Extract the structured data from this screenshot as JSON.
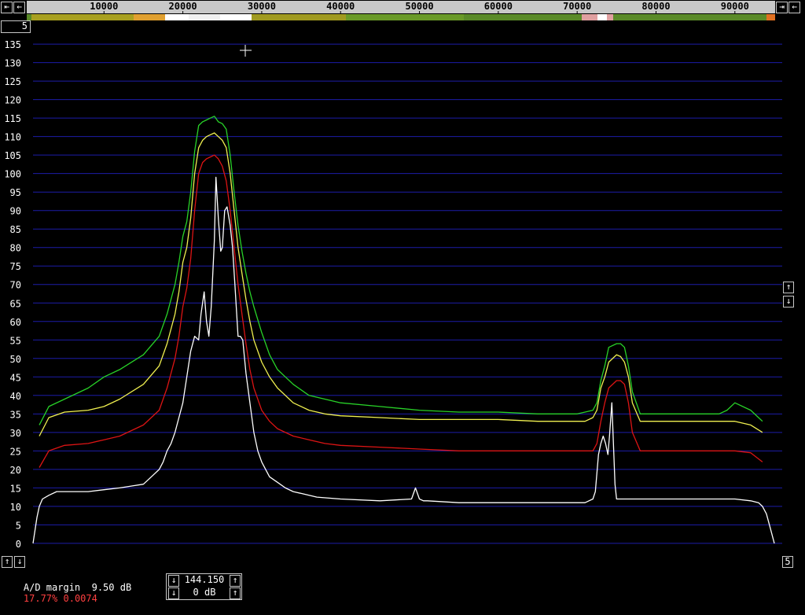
{
  "colors": {
    "background": "#000000",
    "grid": "#1c1ca8",
    "axis_text": "#ffffff",
    "frequency_ruler_bg": "#c8c8c8",
    "trace_green": "#28d228",
    "trace_yellow": "#f0f050",
    "trace_red": "#dc1414",
    "trace_white": "#ffffff",
    "status_red": "#ff4040"
  },
  "frequency_bar": {
    "left_buttons": [
      "left-arrow-icon",
      "left-arrow-icon"
    ],
    "right_buttons": [
      "right-arrow-icon",
      "left-arrow-icon"
    ],
    "top_left_box": "5"
  },
  "right_controls": {
    "up_icon": "up-arrow-icon",
    "down_icon": "down-arrow-icon",
    "bottom_right_box": "5"
  },
  "left_controls": {
    "up_icon": "up-arrow-icon",
    "down_icon": "down-arrow-icon"
  },
  "status": {
    "ad_margin_label": "A/D margin",
    "ad_margin_value": "9.50 dB",
    "percent": "17.77%",
    "ratio": "0.0074"
  },
  "freq_box": {
    "frequency": "144.150",
    "gain": "0 dB"
  },
  "chart_data": {
    "type": "line",
    "title": "",
    "xlabel": "",
    "ylabel": "",
    "x_ticks": [
      10000,
      20000,
      30000,
      40000,
      50000,
      60000,
      70000,
      80000,
      90000
    ],
    "x_tick_labels": [
      "10000",
      "20000",
      "30000",
      "40000",
      "50000",
      "60000",
      "70000",
      "80000",
      "90000"
    ],
    "xlim": [
      1000,
      96000
    ],
    "y_ticks": [
      0,
      5,
      10,
      15,
      20,
      25,
      30,
      35,
      40,
      45,
      50,
      55,
      60,
      65,
      70,
      75,
      80,
      85,
      90,
      95,
      100,
      105,
      110,
      115,
      120,
      125,
      130,
      135
    ],
    "y_tick_labels": [
      "0",
      "5",
      "10",
      "15",
      "20",
      "25",
      "30",
      "35",
      "40",
      "45",
      "50",
      "55",
      "60",
      "65",
      "70",
      "75",
      "80",
      "85",
      "90",
      "95",
      "100",
      "105",
      "110",
      "115",
      "120",
      "125",
      "130",
      "135"
    ],
    "ylim": [
      -3,
      138
    ],
    "grid": true,
    "series": [
      {
        "color": "#28d228",
        "x": [
          1800,
          3000,
          5000,
          8000,
          10000,
          12000,
          15000,
          17000,
          18000,
          19000,
          19500,
          20000,
          20500,
          21000,
          21500,
          22000,
          22500,
          23000,
          23500,
          24000,
          24500,
          25000,
          25500,
          26000,
          26500,
          27000,
          27500,
          28000,
          28500,
          29000,
          30000,
          31000,
          32000,
          34000,
          36000,
          38000,
          40000,
          45000,
          50000,
          55000,
          60000,
          65000,
          70000,
          71000,
          72000,
          72500,
          73000,
          73500,
          74000,
          75000,
          75500,
          76000,
          76500,
          77000,
          78000,
          80000,
          85000,
          88000,
          89000,
          90000,
          92000,
          93000,
          93500
        ],
        "y": [
          32,
          37,
          39,
          42,
          45,
          47,
          51,
          56,
          62,
          70,
          76,
          83,
          87,
          95,
          106,
          113,
          114,
          114.5,
          115,
          115.5,
          114,
          113.5,
          112,
          105,
          95,
          86,
          79,
          73,
          68,
          64,
          57,
          51,
          47,
          43,
          40,
          39,
          38,
          37,
          36,
          35.5,
          35.5,
          35,
          35,
          35.5,
          36,
          38,
          44,
          48,
          53,
          54,
          54,
          53,
          48,
          41,
          35,
          35,
          35,
          35,
          36,
          38,
          36,
          34,
          33
        ]
      },
      {
        "color": "#f0f050",
        "x": [
          1800,
          3000,
          5000,
          8000,
          10000,
          12000,
          15000,
          17000,
          18000,
          19000,
          19500,
          20000,
          20500,
          21000,
          21500,
          22000,
          22500,
          23000,
          23500,
          24000,
          24500,
          25000,
          25500,
          26000,
          26500,
          27000,
          27500,
          28000,
          28500,
          29000,
          30000,
          31000,
          32000,
          34000,
          36000,
          38000,
          40000,
          45000,
          50000,
          55000,
          60000,
          65000,
          70000,
          71000,
          72000,
          72500,
          73000,
          73500,
          74000,
          75000,
          75500,
          76000,
          76500,
          77000,
          78000,
          80000,
          85000,
          90000,
          92000,
          93500
        ],
        "y": [
          29,
          34,
          35.5,
          36,
          37,
          39,
          43,
          48,
          54,
          62,
          68,
          76,
          80,
          88,
          100,
          107,
          109,
          110,
          110.5,
          111,
          110,
          109,
          107,
          100,
          90,
          80,
          73,
          66,
          60,
          55,
          49,
          45,
          42,
          38,
          36,
          35,
          34.5,
          34,
          33.5,
          33.5,
          33.5,
          33,
          33,
          33,
          34,
          36,
          42,
          45,
          49,
          51,
          50.5,
          49,
          45,
          38,
          33,
          33,
          33,
          33,
          32,
          30
        ]
      },
      {
        "color": "#dc1414",
        "x": [
          1800,
          3000,
          5000,
          8000,
          10000,
          12000,
          15000,
          17000,
          18000,
          19000,
          19500,
          20000,
          20500,
          21000,
          21500,
          22000,
          22500,
          23000,
          23500,
          24000,
          24500,
          25000,
          25500,
          26000,
          26500,
          27000,
          27500,
          28000,
          28500,
          29000,
          30000,
          31000,
          32000,
          34000,
          36000,
          38000,
          40000,
          45000,
          50000,
          55000,
          60000,
          65000,
          70000,
          71000,
          72000,
          72500,
          73000,
          73500,
          74000,
          75000,
          75500,
          76000,
          76500,
          77000,
          78000,
          80000,
          85000,
          90000,
          92000,
          93500
        ],
        "y": [
          20.5,
          25,
          26.5,
          27,
          28,
          29,
          32,
          36,
          42,
          50,
          56,
          64,
          69,
          77,
          90,
          100,
          103,
          104,
          104.5,
          105,
          104,
          102,
          98,
          90,
          80,
          70,
          62,
          54,
          47,
          42,
          36,
          33,
          31,
          29,
          28,
          27,
          26.5,
          26,
          25.5,
          25,
          25,
          25,
          25,
          25,
          25,
          27,
          33,
          38,
          42,
          44,
          44,
          43,
          38,
          30,
          25,
          25,
          25,
          25,
          24.5,
          22
        ]
      },
      {
        "color": "#ffffff",
        "x": [
          1000,
          1500,
          1800,
          2200,
          3000,
          4000,
          6000,
          8000,
          10000,
          12000,
          13500,
          15000,
          16000,
          17000,
          17500,
          18000,
          18500,
          19000,
          19500,
          20000,
          20500,
          21000,
          21500,
          22000,
          22300,
          22700,
          23000,
          23300,
          23600,
          24000,
          24200,
          24500,
          24800,
          25000,
          25300,
          25600,
          26000,
          26300,
          26600,
          27000,
          27300,
          27600,
          28000,
          28500,
          29000,
          29500,
          30000,
          30500,
          31000,
          32000,
          33000,
          34000,
          35000,
          37000,
          40000,
          45000,
          49000,
          49500,
          50000,
          50500,
          51000,
          55000,
          60000,
          65000,
          70000,
          71000,
          71500,
          72000,
          72300,
          72700,
          73000,
          73300,
          73600,
          73900,
          74100,
          74400,
          74800,
          75000,
          75500,
          76000,
          80000,
          85000,
          90000,
          92000,
          93000,
          93500,
          94000,
          94500,
          95000
        ],
        "y": [
          0,
          7,
          10,
          12,
          13,
          14,
          14,
          14,
          14.5,
          15,
          15.5,
          16,
          18,
          20,
          22,
          25,
          27,
          30,
          34,
          38,
          45,
          52,
          56,
          55,
          62,
          68,
          60,
          56,
          64,
          82,
          99,
          88,
          79,
          80,
          90,
          91,
          86,
          80,
          70,
          56,
          56,
          55,
          46,
          38,
          30,
          25,
          22,
          20,
          18,
          16.5,
          15,
          14,
          13.5,
          12.5,
          12,
          11.5,
          12,
          15,
          12,
          11.5,
          11.5,
          11,
          11,
          11,
          11,
          11,
          11.5,
          12,
          14,
          24,
          27,
          29,
          27,
          24,
          29,
          38,
          16,
          12,
          12,
          12,
          12,
          12,
          12,
          11.5,
          11,
          10,
          8,
          4,
          0
        ]
      }
    ]
  }
}
